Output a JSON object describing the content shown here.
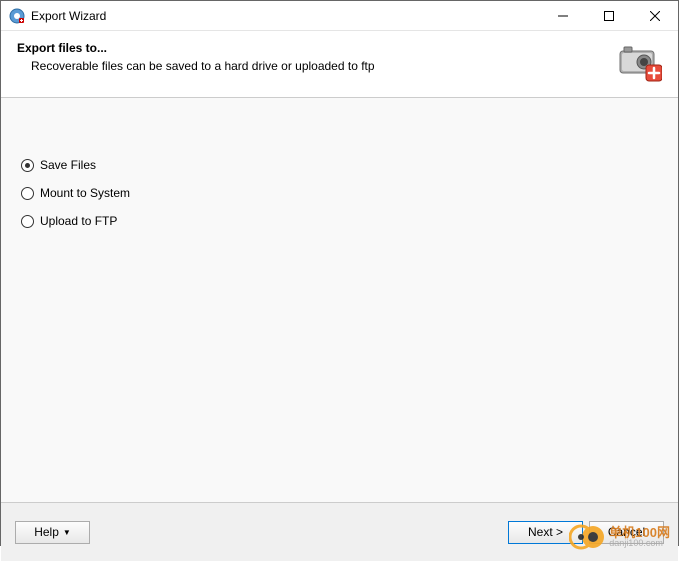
{
  "window": {
    "title": "Export Wizard"
  },
  "header": {
    "title": "Export files to...",
    "subtitle": "Recoverable files can be saved to a hard drive or uploaded to ftp"
  },
  "options": {
    "save_files": "Save Files",
    "mount_system": "Mount to System",
    "upload_ftp": "Upload to FTP",
    "selected": "save_files"
  },
  "footer": {
    "help": "Help",
    "next": "Next >",
    "cancel": "Cancel"
  },
  "watermark": {
    "line1": "单机100网",
    "line2": "danji100.com"
  }
}
